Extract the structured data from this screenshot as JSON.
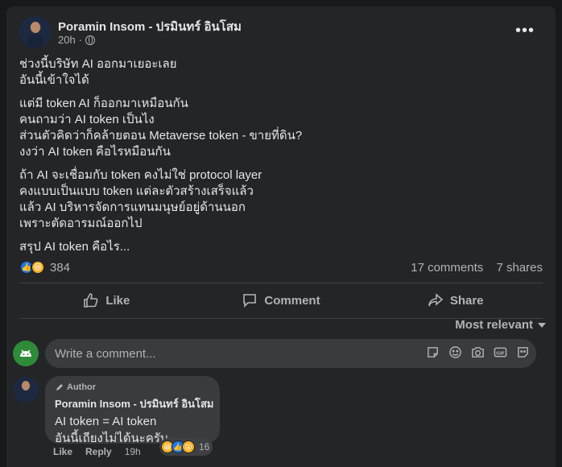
{
  "post": {
    "author_name": "Poramin Insom - ปรมินทร์ อินโสม",
    "timestamp": "20h",
    "separator": "·",
    "audience_icon": "globe-icon",
    "more_icon": "ellipsis-icon",
    "paragraphs": [
      [
        "ช่วงนี้บริษัท AI ออกมาเยอะเลย",
        "อันนี้เข้าใจได้"
      ],
      [
        "แต่มี token AI ก็ออกมาเหมือนกัน",
        "คนถามว่า AI token เป็นไง",
        "ส่วนตัวคิดว่าก็คล้ายตอน Metaverse token - ขายที่ดิน?",
        "งงว่า AI token คือไรหมือนกัน"
      ],
      [
        "ถ้า AI จะเชื่อมกับ token คงไม่ใช่ protocol layer",
        "คงแบบเป็นแบบ token แต่ละตัวสร้างเสร็จแล้ว",
        "แล้ว AI บริหารจัดการแทนมนุษย์อยู่ด้านนอก",
        "เพราะตัดอารมณ์ออกไป"
      ],
      [
        "สรุป AI token คือไร..."
      ]
    ]
  },
  "stats": {
    "reaction_count": "384",
    "reaction_icons": [
      "like-reaction-icon",
      "haha-reaction-icon"
    ],
    "comments": "17 comments",
    "shares": "7 shares"
  },
  "actions": {
    "like": "Like",
    "comment": "Comment",
    "share": "Share"
  },
  "sort": {
    "label": "Most relevant"
  },
  "composer": {
    "placeholder": "Write a comment...",
    "icons": [
      "sticker-icon",
      "emoji-icon",
      "camera-icon",
      "gif-icon",
      "sticker-face-icon"
    ]
  },
  "comment": {
    "badge": "Author",
    "author_name": "Poramin Insom - ปรมินทร์ อินโสม",
    "lines": [
      "AI token = AI token",
      "อันนี้เถียงไม่ได้นะครับ"
    ],
    "reaction_count": "16",
    "reaction_icons": [
      "haha-reaction-icon",
      "like-reaction-icon",
      "wow-reaction-icon"
    ],
    "like_label": "Like",
    "reply_label": "Reply",
    "time": "19h"
  },
  "colors": {
    "background": "#18191a",
    "card": "#242526",
    "bubble": "#3a3b3c",
    "text": "#e4e6eb",
    "secondary_text": "#b0b3b8",
    "like_blue": "#1877f2",
    "haha_yellow": "#f7b125"
  }
}
